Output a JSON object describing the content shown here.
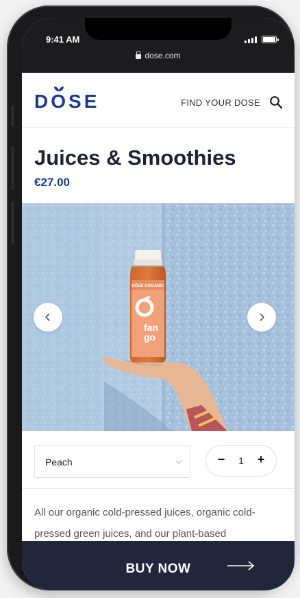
{
  "status_bar": {
    "time": "9:41 AM",
    "url": "dose.com"
  },
  "header": {
    "logo_text": "DOSE",
    "nav_label": "FIND YOUR DOSE",
    "search_icon": "search-icon"
  },
  "product": {
    "title": "Juices & Smoothies",
    "price": "€27.00",
    "bottle_brand": "DŌSE ORGANIC",
    "bottle_name_1": "fan",
    "bottle_name_2": "go"
  },
  "carousel": {
    "prev_icon": "chevron-left-icon",
    "next_icon": "chevron-right-icon"
  },
  "options": {
    "flavor_selected": "Peach",
    "quantity": "1",
    "minus_label": "−",
    "plus_label": "+"
  },
  "description": "All our organic cold-pressed juices, organic cold-pressed green juices, and our plant-based",
  "buy": {
    "label": "BUY NOW",
    "icon": "arrow-right-icon"
  },
  "colors": {
    "brand_blue": "#1c3a8f",
    "dark": "#22263a",
    "wall_blue": "#a9c3dd",
    "bottle_orange": "#f0a07a"
  }
}
